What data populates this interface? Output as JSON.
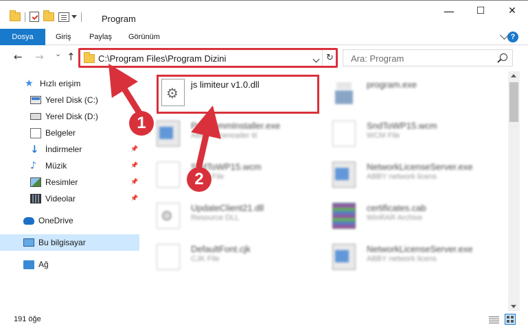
{
  "window": {
    "title": "Program",
    "minimize": "—",
    "maximize": "☐",
    "close": "✕"
  },
  "ribbon": {
    "tabs": [
      "Dosya",
      "Giriş",
      "Paylaş",
      "Görünüm"
    ],
    "help": "?"
  },
  "nav": {
    "back": "←",
    "forward": "→",
    "recent": "⌄",
    "up": "↑",
    "address": "C:\\Program Files\\Program Dizini",
    "refresh": "↻",
    "search_placeholder": "Ara: Program"
  },
  "sidebar": {
    "items": [
      {
        "label": "Hızlı erişim",
        "icon": "star-icon"
      },
      {
        "label": "Yerel Disk (C:)",
        "icon": "drive-icon"
      },
      {
        "label": "Yerel Disk (D:)",
        "icon": "drive-icon"
      },
      {
        "label": "Belgeler",
        "icon": "documents-icon"
      },
      {
        "label": "İndirmeler",
        "icon": "download-icon"
      },
      {
        "label": "Müzik",
        "icon": "music-icon"
      },
      {
        "label": "Resimler",
        "icon": "pictures-icon"
      },
      {
        "label": "Videolar",
        "icon": "videos-icon"
      },
      {
        "label": "OneDrive",
        "icon": "cloud-icon"
      },
      {
        "label": "Bu bilgisayar",
        "icon": "computer-icon"
      },
      {
        "label": "Ağ",
        "icon": "network-icon"
      }
    ],
    "pin_glyph": "📌"
  },
  "files": {
    "highlighted": {
      "name": "js limiteur v1.0.dll"
    },
    "items": [
      {
        "name": "program.exe",
        "sub": ""
      },
      {
        "name": "ProgrammInstaller.exe",
        "sub": "ABBY Finereader tii"
      },
      {
        "name": "SndToWP15.wcm",
        "sub": "WCM File"
      },
      {
        "name": "SndToWP15.wcm",
        "sub": "WCM File"
      },
      {
        "name": "NetworkLicenseServer.exe",
        "sub": "ABBY network licens"
      },
      {
        "name": "UpdateClient21.dll",
        "sub": "Resource DLL"
      },
      {
        "name": "certificates.cab",
        "sub": "WinRAR Archive"
      },
      {
        "name": "DefaultFont.cjk",
        "sub": "CJK File"
      },
      {
        "name": "NetworkLicenseServer.exe",
        "sub": "ABBY network licens"
      }
    ]
  },
  "annotations": {
    "step1": "1",
    "step2": "2",
    "color": "#d9313b"
  },
  "status": {
    "count": "191 öğe"
  }
}
